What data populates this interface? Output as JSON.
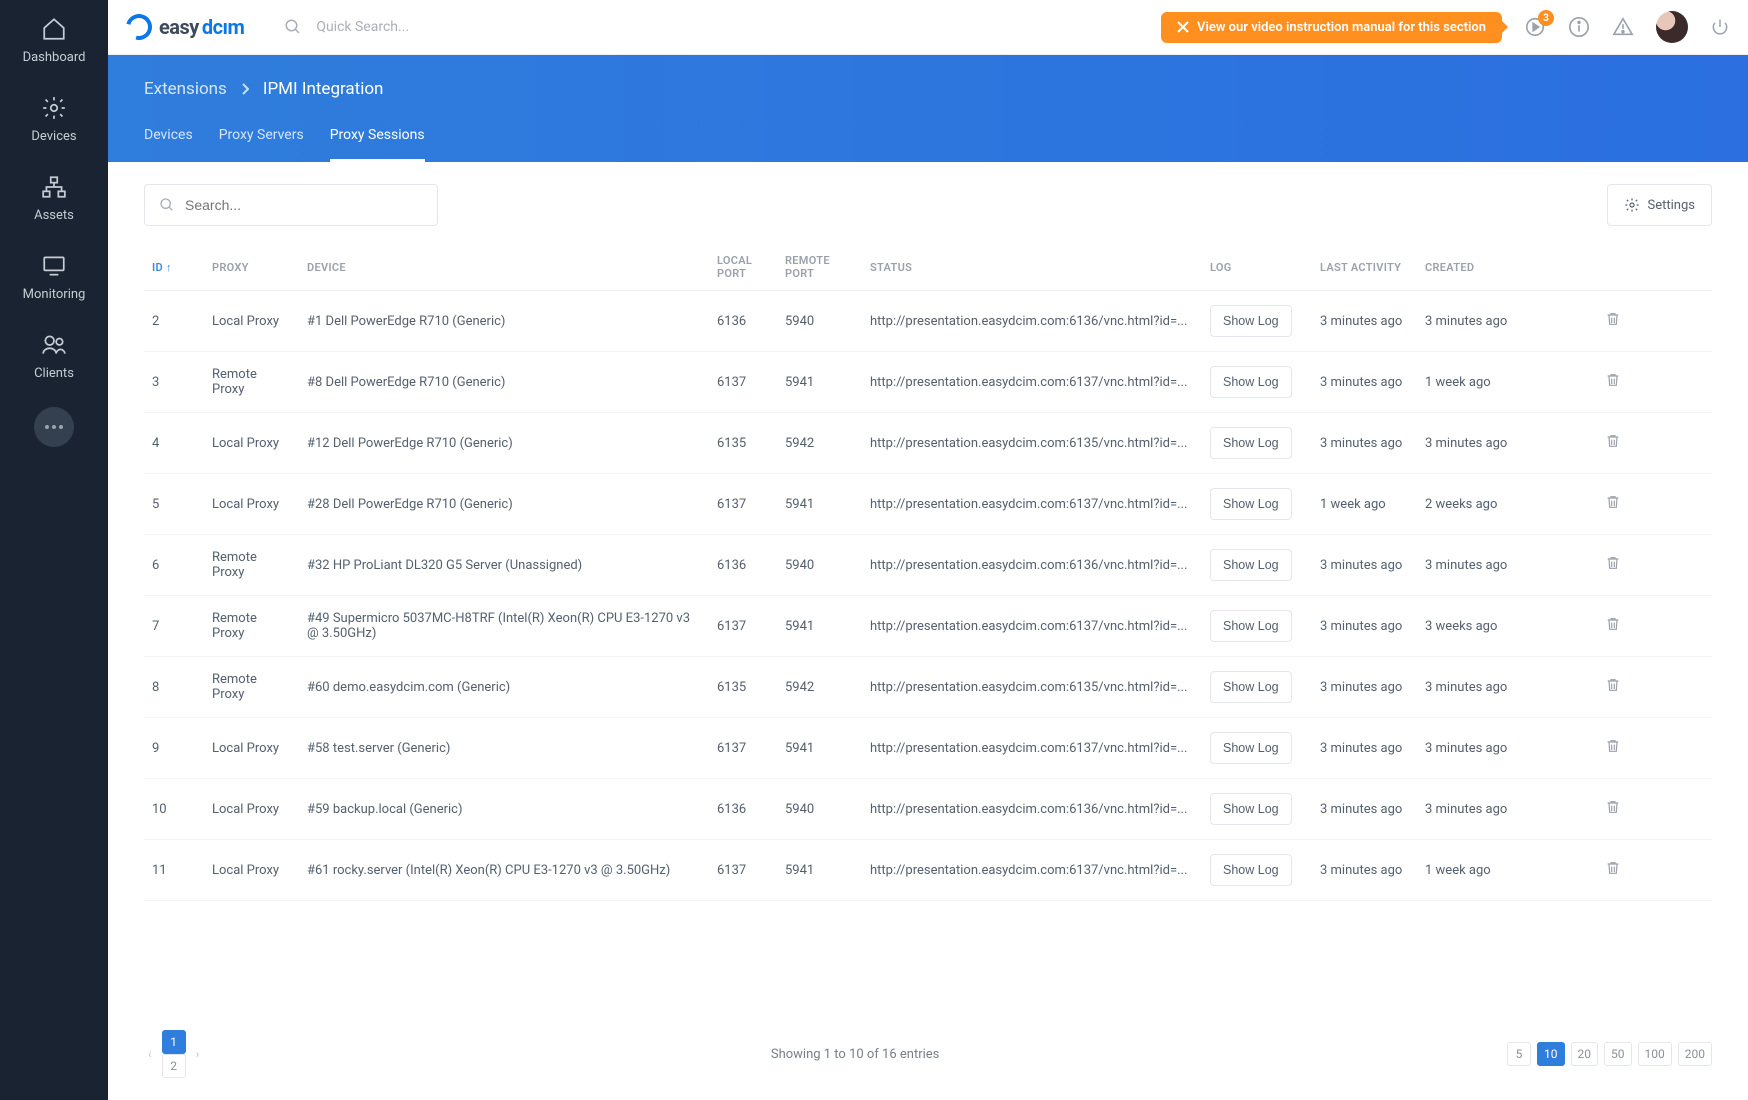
{
  "topbar": {
    "search_placeholder": "Quick Search...",
    "promo_text": "View our video instruction manual for this section",
    "notif_count": "3"
  },
  "sidebar": {
    "items": [
      {
        "label": "Dashboard",
        "icon": "home"
      },
      {
        "label": "Devices",
        "icon": "gear"
      },
      {
        "label": "Assets",
        "icon": "tree"
      },
      {
        "label": "Monitoring",
        "icon": "monitor"
      },
      {
        "label": "Clients",
        "icon": "users"
      }
    ]
  },
  "breadcrumb": {
    "root": "Extensions",
    "page": "IPMI Integration"
  },
  "tabs": [
    "Devices",
    "Proxy Servers",
    "Proxy Sessions"
  ],
  "active_tab": 2,
  "search_placeholder": "Search...",
  "settings_label": "Settings",
  "columns": {
    "id": "ID",
    "proxy": "PROXY",
    "device": "DEVICE",
    "local": "LOCAL PORT",
    "remote": "REMOTE PORT",
    "status": "STATUS",
    "log": "LOG",
    "last": "LAST ACTIVITY",
    "created": "CREATED"
  },
  "log_label": "Show Log",
  "rows": [
    {
      "id": "2",
      "proxy": "Local Proxy",
      "device": "#1 Dell PowerEdge R710 (Generic)",
      "lp": "6136",
      "rp": "5940",
      "status": "http://presentation.easydcim.com:6136/vnc.html?id=...",
      "last": "3 minutes ago",
      "created": "3 minutes ago"
    },
    {
      "id": "3",
      "proxy": "Remote Proxy",
      "device": "#8 Dell PowerEdge R710 (Generic)",
      "lp": "6137",
      "rp": "5941",
      "status": "http://presentation.easydcim.com:6137/vnc.html?id=...",
      "last": "3 minutes ago",
      "created": "1 week ago"
    },
    {
      "id": "4",
      "proxy": "Local Proxy",
      "device": "#12 Dell PowerEdge R710 (Generic)",
      "lp": "6135",
      "rp": "5942",
      "status": "http://presentation.easydcim.com:6135/vnc.html?id=...",
      "last": "3 minutes ago",
      "created": "3 minutes ago"
    },
    {
      "id": "5",
      "proxy": "Local Proxy",
      "device": "#28 Dell PowerEdge R710 (Generic)",
      "lp": "6137",
      "rp": "5941",
      "status": "http://presentation.easydcim.com:6137/vnc.html?id=...",
      "last": "1 week ago",
      "created": "2 weeks ago"
    },
    {
      "id": "6",
      "proxy": "Remote Proxy",
      "device": "#32 HP ProLiant DL320 G5 Server (Unassigned)",
      "lp": "6136",
      "rp": "5940",
      "status": "http://presentation.easydcim.com:6136/vnc.html?id=...",
      "last": "3 minutes ago",
      "created": "3 minutes ago"
    },
    {
      "id": "7",
      "proxy": "Remote Proxy",
      "device": "#49 Supermicro 5037MC-H8TRF (Intel(R) Xeon(R) CPU E3-1270 v3 @ 3.50GHz)",
      "lp": "6137",
      "rp": "5941",
      "status": "http://presentation.easydcim.com:6137/vnc.html?id=...",
      "last": "3 minutes ago",
      "created": "3 weeks ago"
    },
    {
      "id": "8",
      "proxy": "Remote Proxy",
      "device": "#60 demo.easydcim.com (Generic)",
      "lp": "6135",
      "rp": "5942",
      "status": "http://presentation.easydcim.com:6135/vnc.html?id=...",
      "last": "3 minutes ago",
      "created": "3 minutes ago"
    },
    {
      "id": "9",
      "proxy": "Local Proxy",
      "device": "#58 test.server (Generic)",
      "lp": "6137",
      "rp": "5941",
      "status": "http://presentation.easydcim.com:6137/vnc.html?id=...",
      "last": "3 minutes ago",
      "created": "3 minutes ago"
    },
    {
      "id": "10",
      "proxy": "Local Proxy",
      "device": "#59 backup.local (Generic)",
      "lp": "6136",
      "rp": "5940",
      "status": "http://presentation.easydcim.com:6136/vnc.html?id=...",
      "last": "3 minutes ago",
      "created": "3 minutes ago"
    },
    {
      "id": "11",
      "proxy": "Local Proxy",
      "device": "#61 rocky.server (Intel(R) Xeon(R) CPU E3-1270 v3 @ 3.50GHz)",
      "lp": "6137",
      "rp": "5941",
      "status": "http://presentation.easydcim.com:6137/vnc.html?id=...",
      "last": "3 minutes ago",
      "created": "1 week ago"
    }
  ],
  "pagination": {
    "pages": [
      "1",
      "2"
    ],
    "active": 0,
    "summary": "Showing 1 to 10 of 16 entries",
    "sizes": [
      "5",
      "10",
      "20",
      "50",
      "100",
      "200"
    ],
    "active_size": 1
  }
}
